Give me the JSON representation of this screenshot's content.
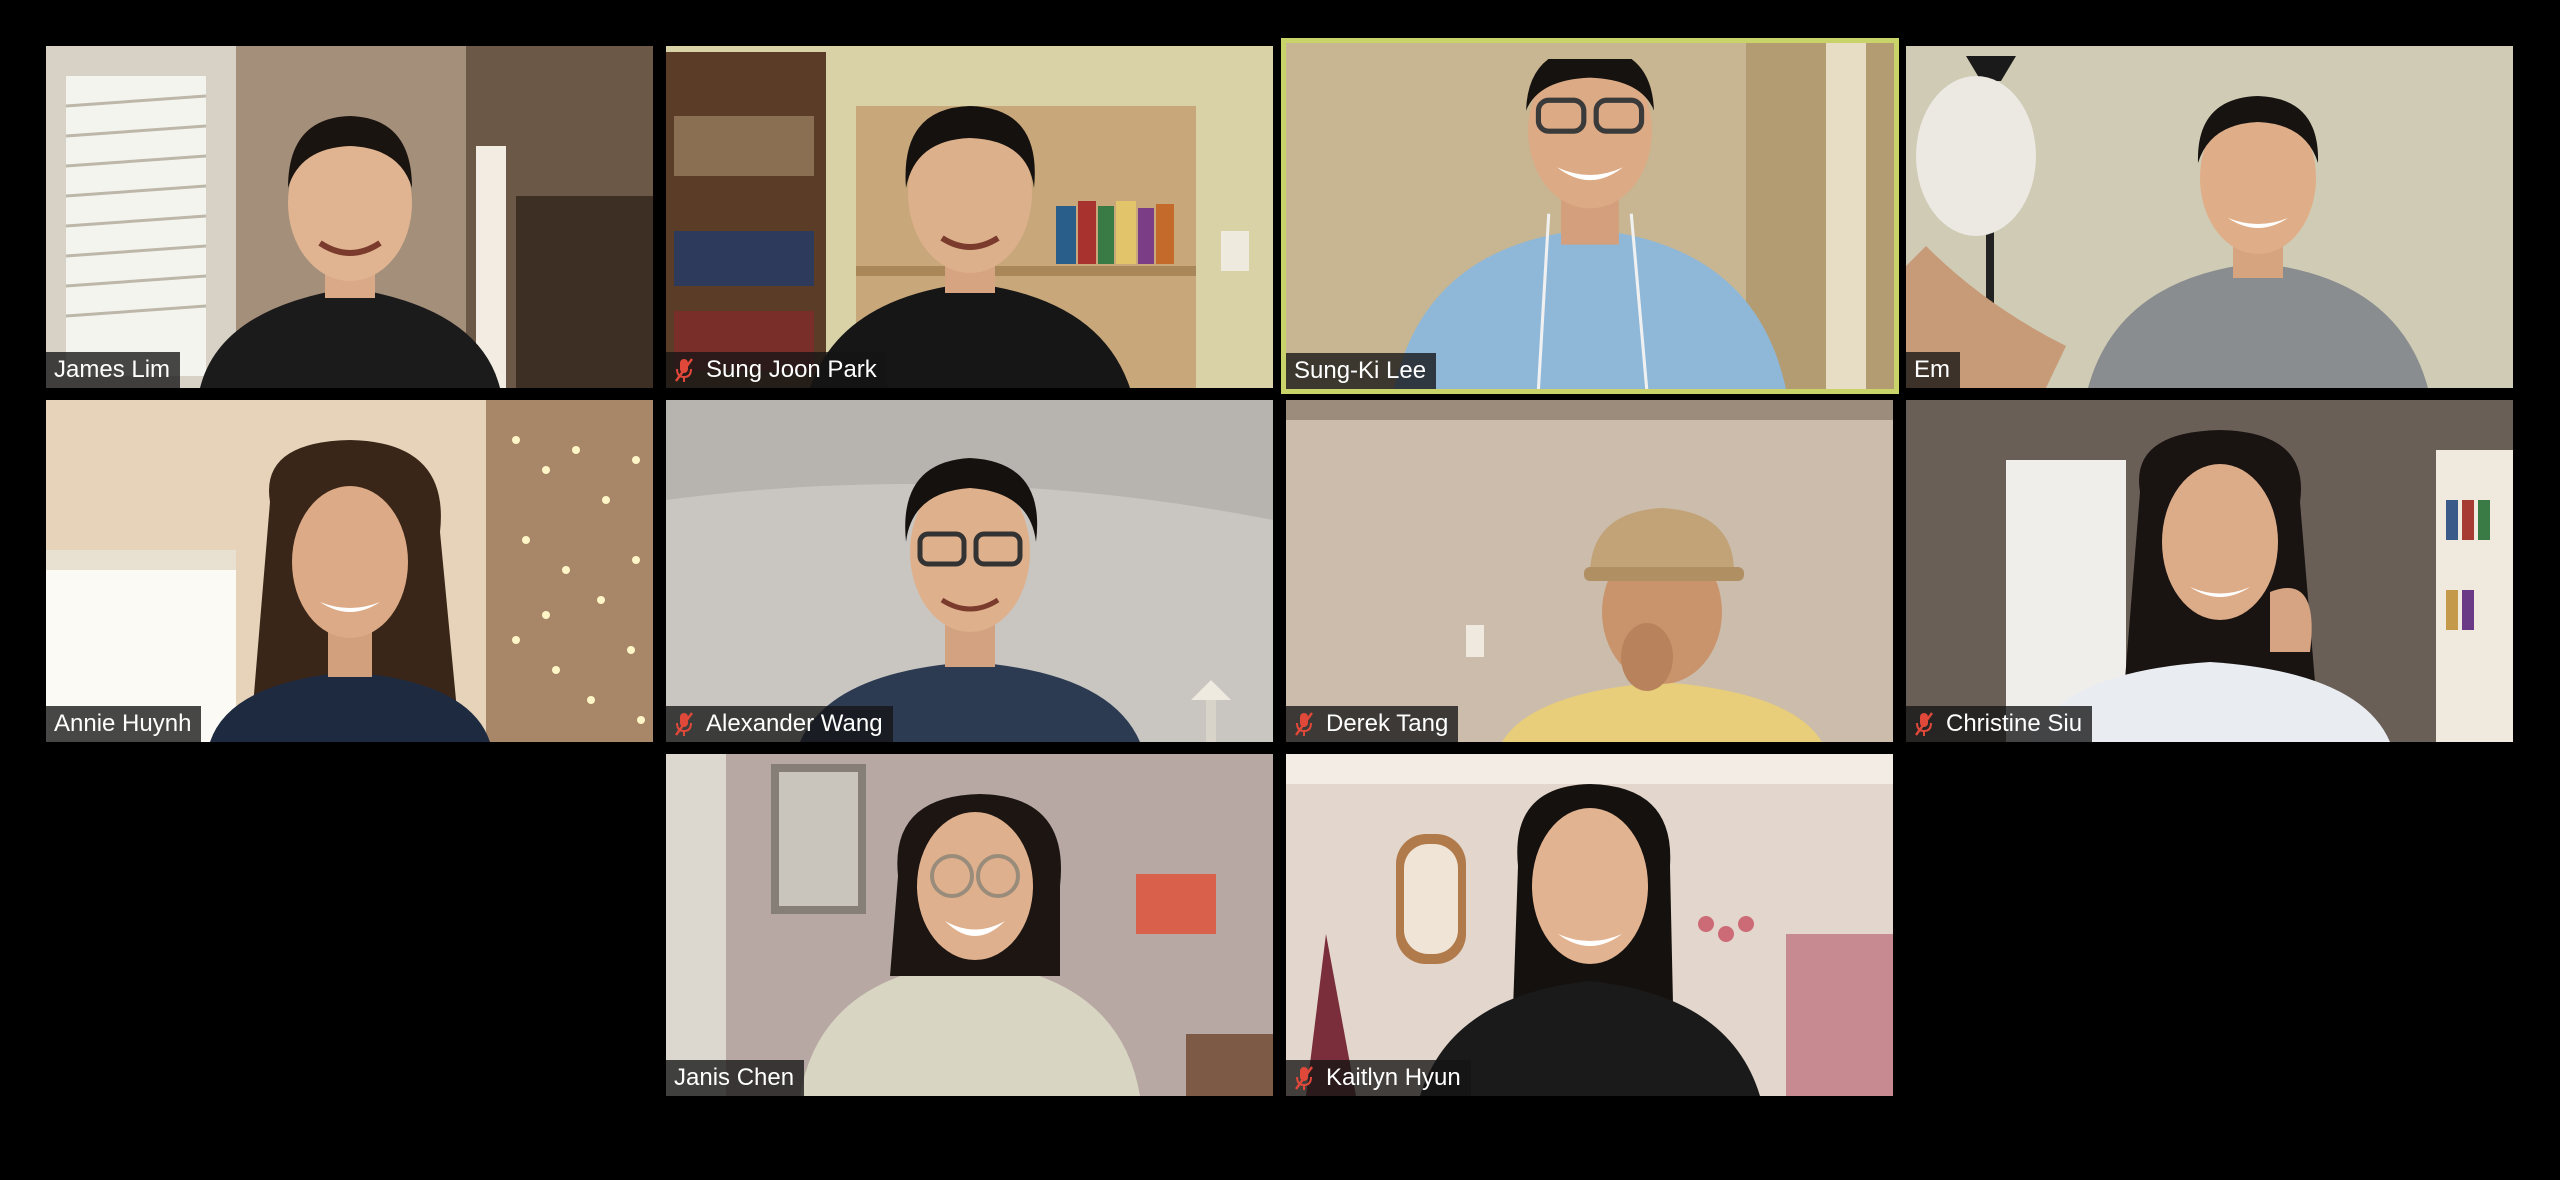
{
  "meeting": {
    "view": "gallery",
    "participants": [
      {
        "name": "James Lim",
        "muted": false,
        "active_speaker": false
      },
      {
        "name": "Sung Joon Park",
        "muted": true,
        "active_speaker": false
      },
      {
        "name": "Sung-Ki Lee",
        "muted": false,
        "active_speaker": true
      },
      {
        "name": "Em",
        "muted": false,
        "active_speaker": false
      },
      {
        "name": "Annie Huynh",
        "muted": false,
        "active_speaker": false
      },
      {
        "name": "Alexander Wang",
        "muted": true,
        "active_speaker": false
      },
      {
        "name": "Derek Tang",
        "muted": true,
        "active_speaker": false
      },
      {
        "name": "Christine Siu",
        "muted": true,
        "active_speaker": false
      },
      {
        "name": "Janis Chen",
        "muted": false,
        "active_speaker": false
      },
      {
        "name": "Kaitlyn Hyun",
        "muted": true,
        "active_speaker": false
      }
    ]
  },
  "colors": {
    "background": "#000000",
    "active_speaker_border": "#c8d36a",
    "mute_icon": "#e0483a",
    "nametag_bg": "rgba(20,20,20,0.78)",
    "nametag_text": "#ffffff"
  },
  "icons": {
    "mute": "microphone-muted-icon"
  }
}
